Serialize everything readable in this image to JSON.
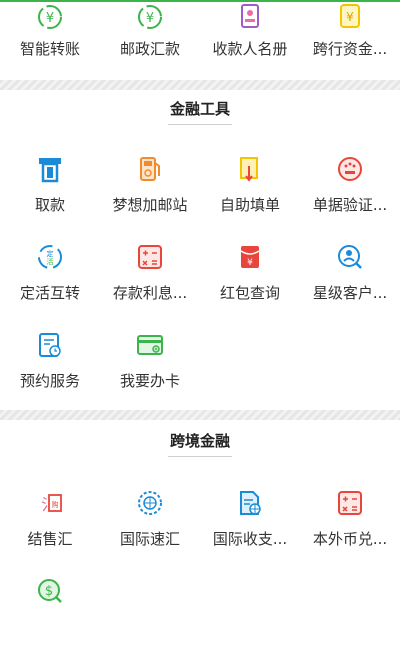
{
  "colors": {
    "green": "#3bb54a",
    "blue": "#1a8bd6",
    "orange": "#f28b2b",
    "red": "#e8453c",
    "pink": "#e86fa0",
    "yellow": "#f5c400",
    "purple": "#a15bc9",
    "teal": "#19b3a5"
  },
  "top_row": [
    {
      "label": "智能转账",
      "icon": "yuan-exchange-icon"
    },
    {
      "label": "邮政汇款",
      "icon": "yuan-transfer-icon"
    },
    {
      "label": "收款人名册",
      "icon": "payee-book-icon"
    },
    {
      "label": "跨行资金...",
      "icon": "yuan-cross-bank-icon"
    }
  ],
  "sections": {
    "finance_tools": {
      "title": "金融工具",
      "items": [
        {
          "label": "取款",
          "icon": "atm-withdraw-icon"
        },
        {
          "label": "梦想加邮站",
          "icon": "gas-pump-icon"
        },
        {
          "label": "自助填单",
          "icon": "fill-form-icon"
        },
        {
          "label": "单据验证...",
          "icon": "seal-verify-icon"
        },
        {
          "label": "定活互转",
          "icon": "fixed-current-swap-icon"
        },
        {
          "label": "存款利息...",
          "icon": "calculator-icon"
        },
        {
          "label": "红包查询",
          "icon": "red-envelope-icon"
        },
        {
          "label": "星级客户...",
          "icon": "star-customer-search-icon"
        },
        {
          "label": "预约服务",
          "icon": "appointment-icon"
        },
        {
          "label": "我要办卡",
          "icon": "apply-card-icon"
        }
      ]
    },
    "cross_border": {
      "title": "跨境金融",
      "items": [
        {
          "label": "结售汇",
          "icon": "fx-settlement-icon"
        },
        {
          "label": "国际速汇",
          "icon": "globe-remit-icon"
        },
        {
          "label": "国际收支...",
          "icon": "intl-balance-doc-icon"
        },
        {
          "label": "本外币兑...",
          "icon": "currency-exchange-calculator-icon"
        },
        {
          "label": "",
          "icon": "dollar-search-icon"
        }
      ]
    }
  }
}
